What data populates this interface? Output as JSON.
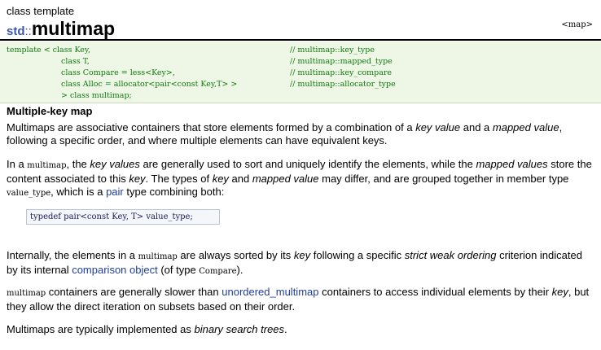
{
  "header": {
    "kind": "class template",
    "namespace": "std",
    "separator": "::",
    "name": "multimap",
    "header_tag": "<map>"
  },
  "declaration": {
    "rows": [
      {
        "c1": "template < class Key,",
        "c2": "",
        "c3": "// multimap::key_type"
      },
      {
        "c1": "",
        "c2": "class T,",
        "c3": "// multimap::mapped_type"
      },
      {
        "c1": "",
        "c2": "class Compare = less<Key>,",
        "c3": "// multimap::key_compare"
      },
      {
        "c1": "",
        "c2": "class Alloc = allocator<pair<const Key,T> >",
        "c3": "// multimap::allocator_type"
      },
      {
        "c1": "",
        "c2": "> class multimap;",
        "c3": ""
      }
    ]
  },
  "section_title": "Multiple-key map",
  "paragraphs": {
    "p1": {
      "t1": "Multimaps are associative containers that store elements formed by a combination of a ",
      "i1": "key value",
      "t2": " and a ",
      "i2": "mapped value",
      "t3": ", following a specific order, and where multiple elements can have equivalent keys."
    },
    "p2": {
      "t1": "In a ",
      "c1": "multimap",
      "t2": ", the ",
      "i1": "key values",
      "t3": " are generally used to sort and uniquely identify the elements, while the ",
      "i2": "mapped values",
      "t4": " store the content associated to this ",
      "i3": "key",
      "t5": ". The types of ",
      "i4": "key",
      "t6": " and ",
      "i5": "mapped value",
      "t7": " may differ, and are grouped together in member type ",
      "c2": "value_type",
      "t8": ", which is a ",
      "a1": "pair",
      "t9": " type combining both:"
    },
    "codebox": "typedef pair<const Key, T> value_type;",
    "p3": {
      "t1": "Internally, the elements in a ",
      "c1": "multimap",
      "t2": " are always sorted by its ",
      "i1": "key",
      "t3": " following a specific ",
      "i2": "strict weak ordering",
      "t4": " criterion indicated by its internal ",
      "a1": "comparison object",
      "t5": " (of type ",
      "c2": "Compare",
      "t6": ")."
    },
    "p4": {
      "c1": "multimap",
      "t1": " containers are generally slower than ",
      "a1": "unordered_multimap",
      "t2": " containers to access individual elements by their ",
      "i1": "key",
      "t3": ", but they allow the direct iteration on subsets based on their order."
    },
    "p5": {
      "t1": "Multimaps are typically implemented as ",
      "i1": "binary search trees",
      "t2": "."
    }
  }
}
